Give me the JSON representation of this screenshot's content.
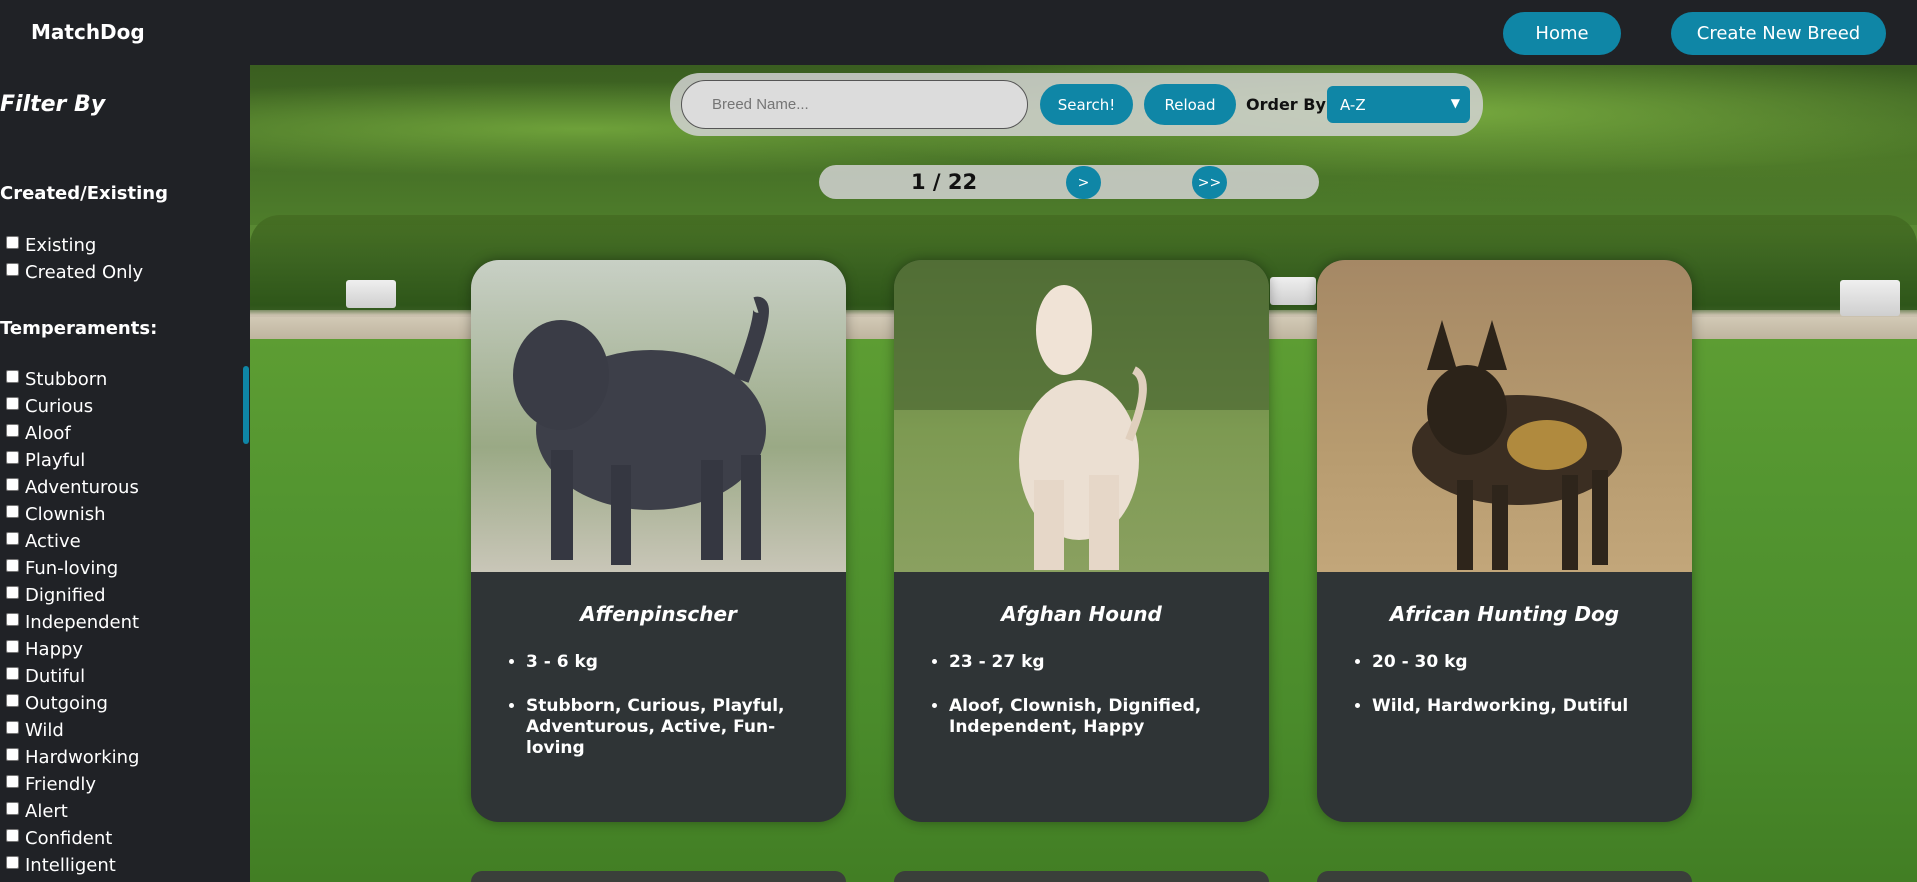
{
  "brand": "MatchDog",
  "nav": {
    "home": "Home",
    "create": "Create New Breed"
  },
  "sidebar": {
    "title": "Filter By",
    "created_section": "Created/Existing",
    "created_options": [
      "Existing",
      "Created Only"
    ],
    "temperaments_section": "Temperaments:",
    "temperaments": [
      "Stubborn",
      "Curious",
      "Aloof",
      "Playful",
      "Adventurous",
      "Clownish",
      "Active",
      "Fun-loving",
      "Dignified",
      "Independent",
      "Happy",
      "Dutiful",
      "Outgoing",
      "Wild",
      "Hardworking",
      "Friendly",
      "Alert",
      "Confident",
      "Intelligent"
    ]
  },
  "search": {
    "placeholder": "Breed Name...",
    "search_label": "Search!",
    "reload_label": "Reload",
    "order_label": "Order By",
    "order_value": "A-Z"
  },
  "pagination": {
    "current": "1 / 22",
    "next": ">",
    "last": ">>"
  },
  "cards": [
    {
      "name": "Affenpinscher",
      "weight": "3 - 6 kg",
      "temperament": "Stubborn, Curious, Playful, Adventurous, Active, Fun-loving"
    },
    {
      "name": "Afghan Hound",
      "weight": "23 - 27 kg",
      "temperament": "Aloof, Clownish, Dignified, Independent, Happy"
    },
    {
      "name": "African Hunting Dog",
      "weight": "20 - 30 kg",
      "temperament": "Wild, Hardworking, Dutiful"
    }
  ],
  "colors": {
    "accent": "#0f86a6",
    "bar": "#202226",
    "card": "#2f3436"
  }
}
